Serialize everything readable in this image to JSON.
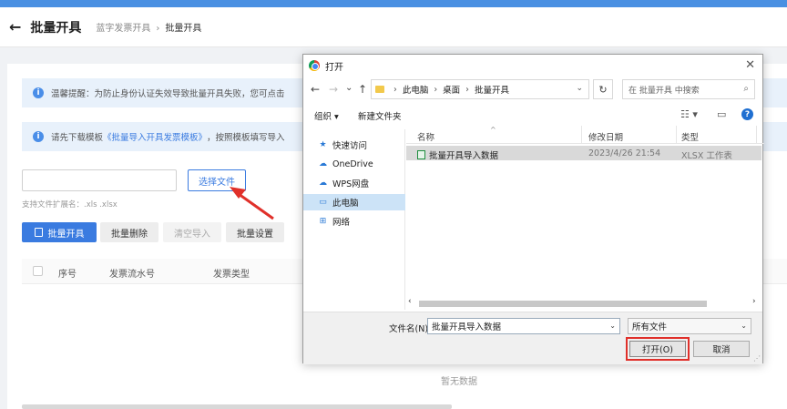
{
  "header": {
    "back_icon": "←",
    "title": "批量开具",
    "breadcrumb": [
      "蓝字发票开具",
      "批量开具"
    ]
  },
  "notices": {
    "tip_text": "温馨提醒：为防止身份认证失效导致批量开具失败，您可点击",
    "template_prefix": "请先下载模板",
    "template_link": "《批量导入开具发票模板》",
    "template_suffix": "，按照模板填写导入"
  },
  "upload": {
    "file_value": "",
    "choose_button": "选择文件",
    "ext_hint": "支持文件扩展名：.xls .xlsx"
  },
  "actions": {
    "batch_issue": "批量开具",
    "batch_delete": "批量删除",
    "clear_import": "清空导入",
    "batch_settings": "批量设置"
  },
  "table": {
    "columns": [
      "序号",
      "发票流水号",
      "发票类型"
    ],
    "empty_text": "暂无数据"
  },
  "dialog": {
    "title": "打开",
    "close_icon": "✕",
    "nav": {
      "back": "←",
      "forward": "→",
      "recent": "⌄",
      "up": "↑"
    },
    "address": [
      "此电脑",
      "桌面",
      "批量开具"
    ],
    "refresh_icon": "↻",
    "search_placeholder": "在 批量开具 中搜索",
    "toolbar": {
      "organize": "组织 ▾",
      "new_folder": "新建文件夹",
      "help": "?"
    },
    "nav_pane": [
      {
        "icon": "★",
        "label": "快速访问"
      },
      {
        "icon": "☁",
        "label": "OneDrive"
      },
      {
        "icon": "☁",
        "label": "WPS网盘"
      },
      {
        "icon": "▭",
        "label": "此电脑"
      },
      {
        "icon": "⊞",
        "label": "网络"
      }
    ],
    "columns": [
      "名称",
      "修改日期",
      "类型"
    ],
    "files": [
      {
        "name": "批量开具导入数据",
        "date": "2023/4/26 21:54",
        "type": "XLSX 工作表"
      }
    ],
    "filename_label": "文件名(N):",
    "filename_value": "批量开具导入数据",
    "filetype_value": "所有文件",
    "open_button": "打开(O)",
    "cancel_button": "取消"
  },
  "colors": {
    "accent": "#3a7be0",
    "highlight_red": "#e0302a"
  }
}
